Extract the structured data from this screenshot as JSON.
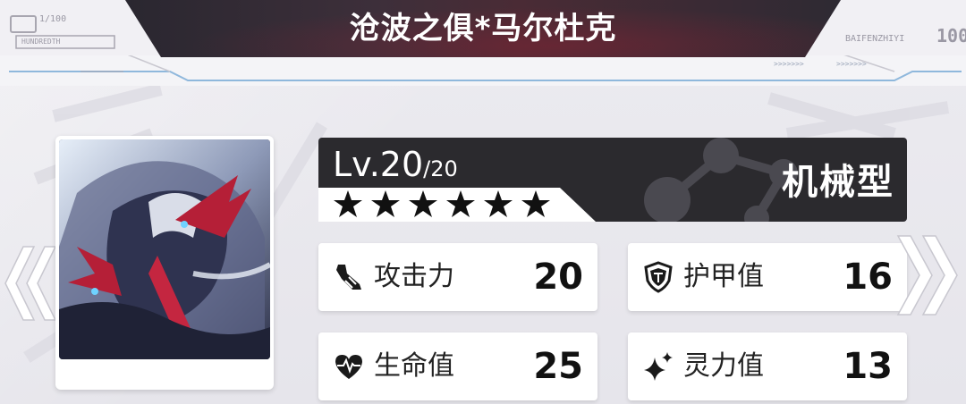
{
  "header": {
    "title": "沧波之俱*马尔杜克",
    "hud_left_count": "1/100",
    "hud_left_word": "HUNDREDTH",
    "hud_right_word": "BAIFENZHIYI",
    "hud_right_num": "100"
  },
  "card": {
    "level_prefix": "Lv.20",
    "level_max": "/20",
    "star_count": 6,
    "type": "机械型"
  },
  "stats": {
    "attack": {
      "label": "攻击力",
      "value": "20"
    },
    "armor": {
      "label": "护甲值",
      "value": "16"
    },
    "life": {
      "label": "生命值",
      "value": "25"
    },
    "spirit": {
      "label": "灵力值",
      "value": "13"
    }
  },
  "colors": {
    "dark_panel": "#2b2a2e",
    "card_bg": "#ffffff",
    "page_bg": "#e9e8ee"
  },
  "icons": {
    "attack": "boot-blade-icon",
    "armor": "shield-icon",
    "life": "heart-pulse-icon",
    "spirit": "sparkle-icon",
    "prev": "double-chevron-left-icon",
    "next": "double-chevron-right-icon"
  }
}
